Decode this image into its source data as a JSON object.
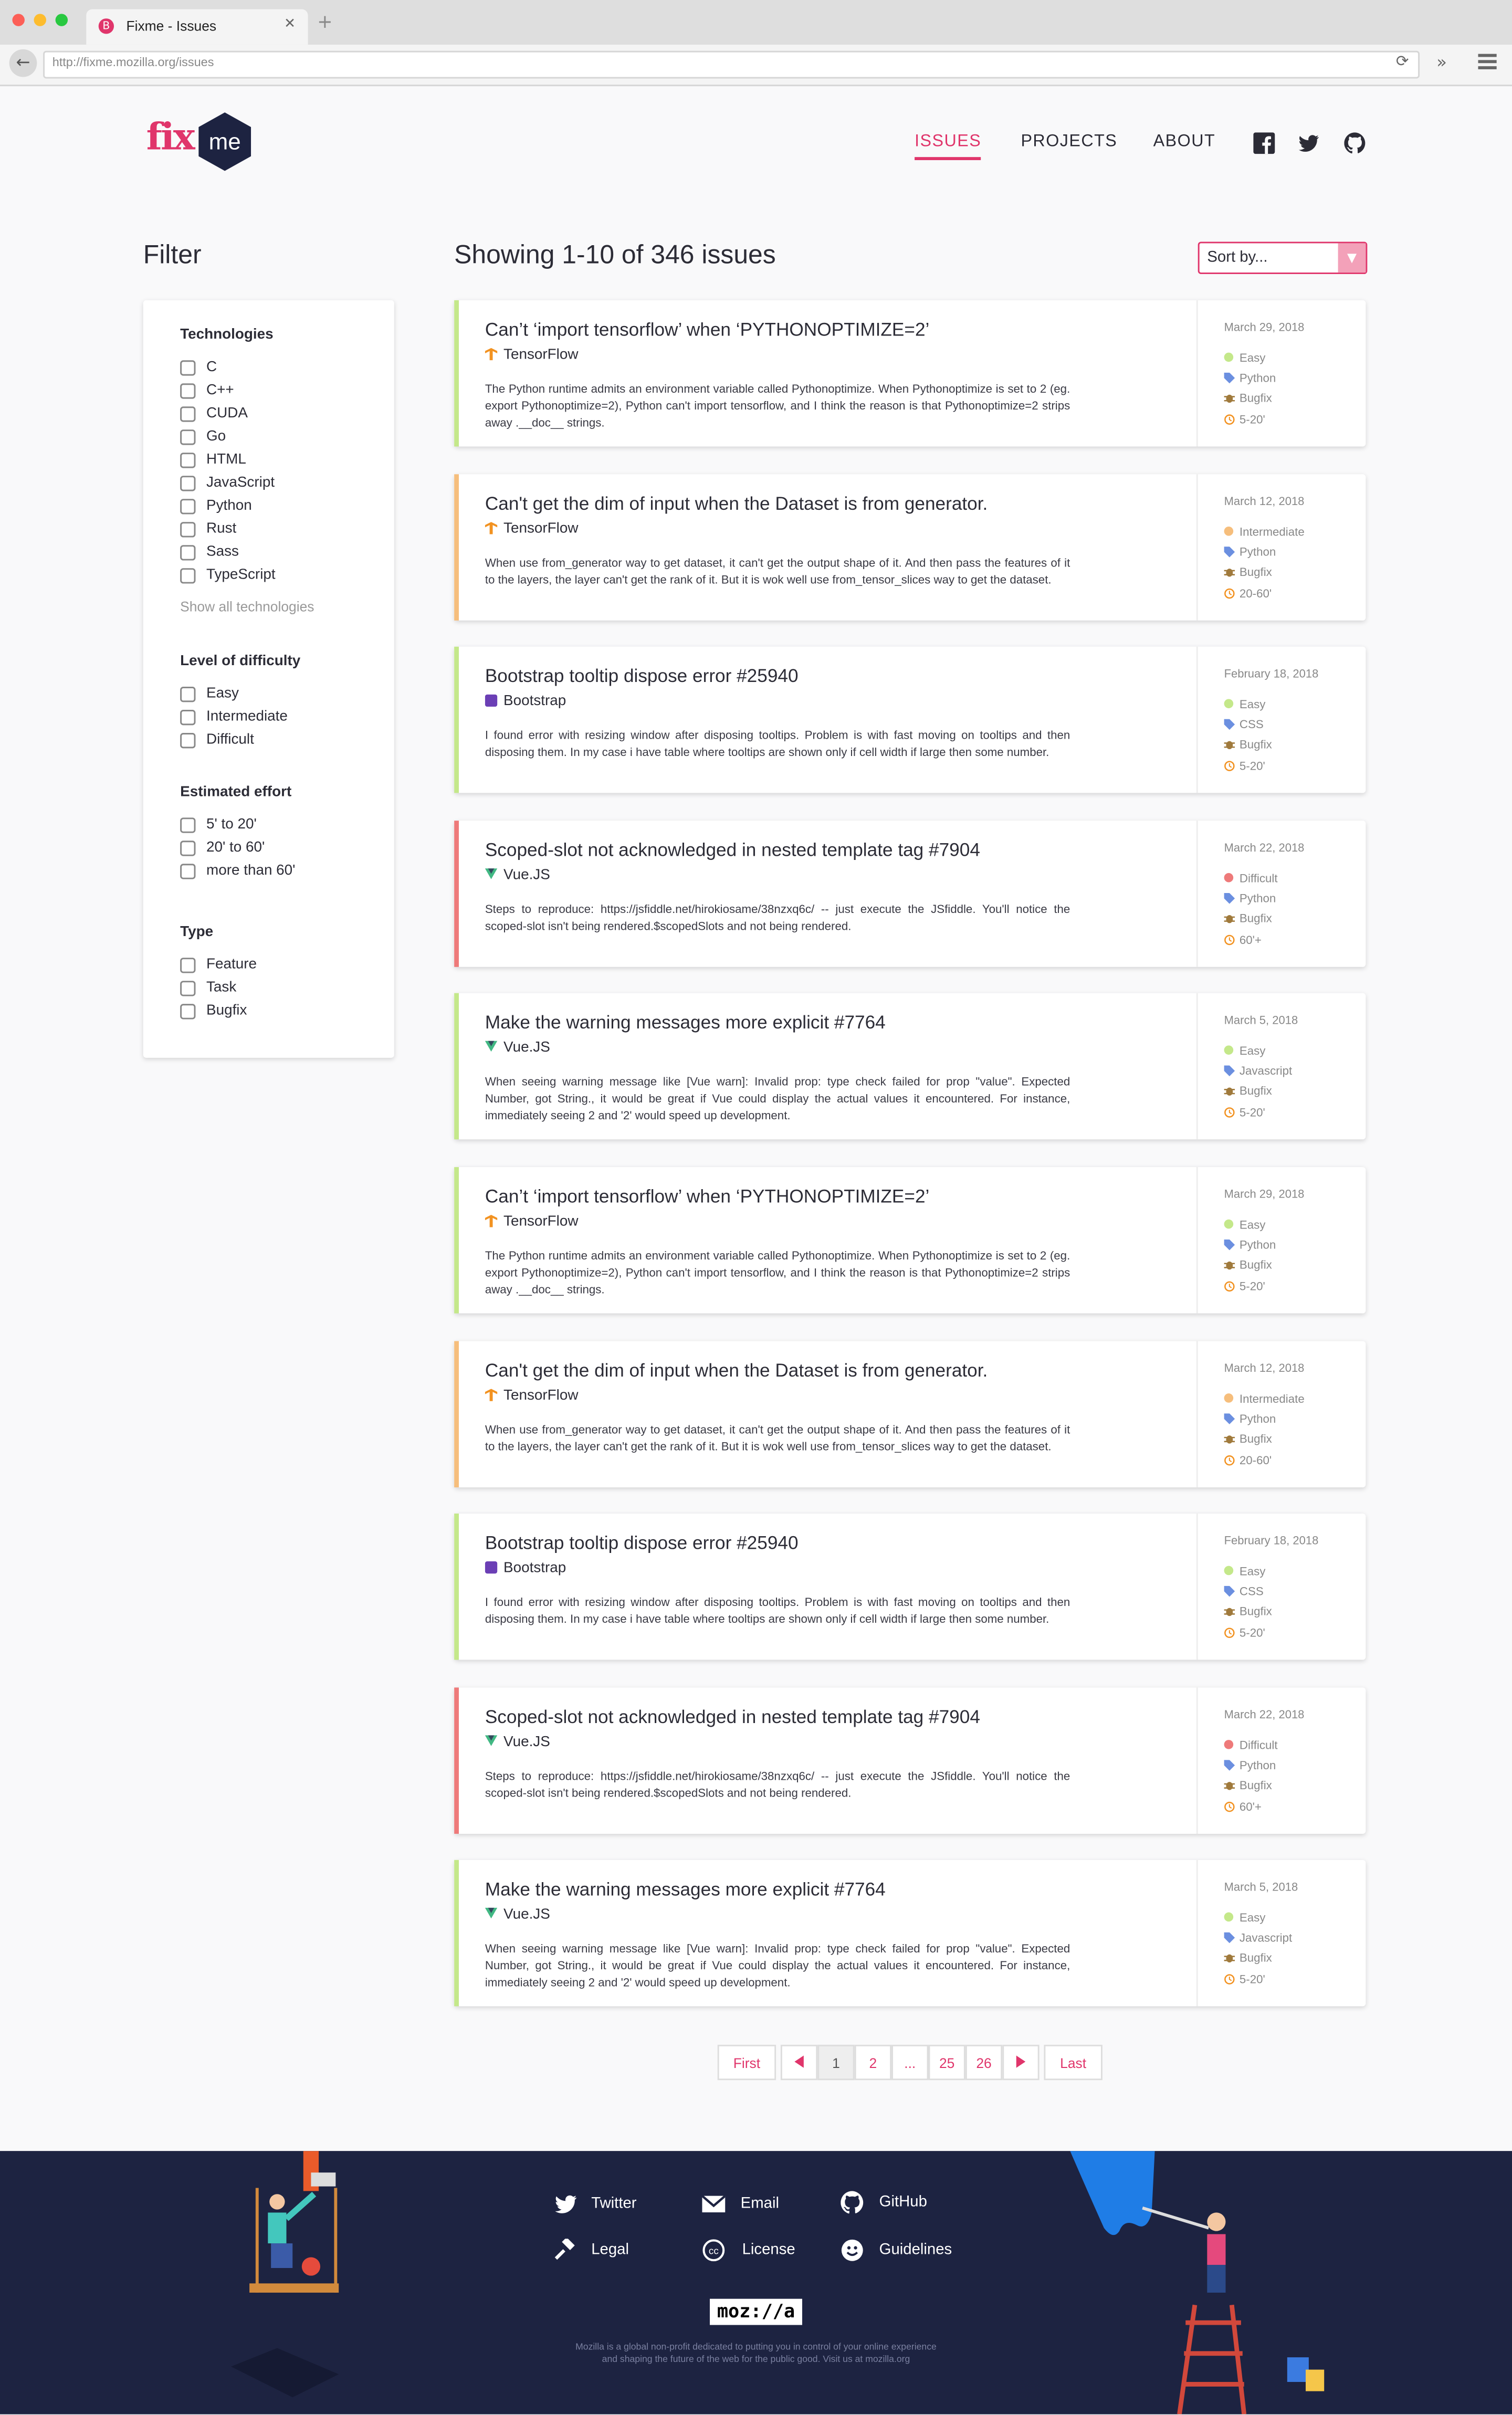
{
  "browser": {
    "tab_title": "Fixme - Issues",
    "url": "http://fixme.mozilla.org/issues"
  },
  "header": {
    "logo_fix": "fix",
    "logo_me": "me",
    "nav": [
      "ISSUES",
      "PROJECTS",
      "ABOUT"
    ]
  },
  "filter": {
    "title": "Filter",
    "groups": [
      {
        "title": "Technologies",
        "options": [
          "C",
          "C++",
          "CUDA",
          "Go",
          "HTML",
          "JavaScript",
          "Python",
          "Rust",
          "Sass",
          "TypeScript"
        ],
        "show_all": "Show all technologies"
      },
      {
        "title": "Level of difficulty",
        "options": [
          "Easy",
          "Intermediate",
          "Difficult"
        ]
      },
      {
        "title": "Estimated effort",
        "options": [
          "5' to 20'",
          "20' to 60'",
          "more than 60'"
        ]
      },
      {
        "title": "Type",
        "options": [
          "Feature",
          "Task",
          "Bugfix"
        ]
      }
    ]
  },
  "results": {
    "showing": "Showing 1-10 of 346 issues",
    "sort_label": "Sort by..."
  },
  "colors": {
    "accent": "#e0356b",
    "easy": "#c4e88a",
    "intermediate": "#f6be7c",
    "difficult": "#ee7a7a",
    "footer_bg": "#1d2341"
  },
  "issues": [
    {
      "title": "Can’t ‘import tensorflow’ when ‘PYTHONOPTIMIZE=2’",
      "tech": "TensorFlow",
      "tech_icon": "tensorflow-icon",
      "desc": "The Python runtime admits an environment variable called Pythonoptimize. When Pythonoptimize is set to 2 (eg. export Pythonoptimize=2), Python can't import tensorflow, and I think the reason is that Pythonoptimize=2 strips away .__doc__ strings.",
      "date": "March 29, 2018",
      "difficulty": "Easy",
      "language": "Python",
      "type": "Bugfix",
      "effort": "5-20'"
    },
    {
      "title": "Can't get the dim of input when the Dataset is from generator.",
      "tech": "TensorFlow",
      "tech_icon": "tensorflow-icon",
      "desc": "When use from_generator way to get dataset, it can't get the output shape of it. And then pass the features of it to the layers, the layer can't get the rank of it. But it is wok well use from_tensor_slices way to get the dataset.",
      "date": "March 12, 2018",
      "difficulty": "Intermediate",
      "language": "Python",
      "type": "Bugfix",
      "effort": "20-60'"
    },
    {
      "title": "Bootstrap tooltip dispose error #25940",
      "tech": "Bootstrap",
      "tech_icon": "bootstrap-icon",
      "desc": "I found error with resizing window after disposing tooltips. Problem is with fast moving on tooltips and then disposing them. In my case i have table where tooltips are shown only if cell width if large then some number.",
      "date": "February 18, 2018",
      "difficulty": "Easy",
      "language": "CSS",
      "type": "Bugfix",
      "effort": "5-20'"
    },
    {
      "title": "Scoped-slot not acknowledged in nested template tag #7904",
      "tech": "Vue.JS",
      "tech_icon": "vue-icon",
      "desc": "Steps to reproduce: https://jsfiddle.net/hirokiosame/38nzxq6c/ -- just execute the JSfiddle. You'll notice the scoped-slot isn't being rendered.$scopedSlots and not being rendered.",
      "date": "March 22, 2018",
      "difficulty": "Difficult",
      "language": "Python",
      "type": "Bugfix",
      "effort": "60'+"
    },
    {
      "title": "Make the warning messages more explicit #7764",
      "tech": "Vue.JS",
      "tech_icon": "vue-icon",
      "desc": "When seeing warning message like [Vue warn]: Invalid prop: type check failed for prop \"value\". Expected Number, got String., it would be great if Vue could display the actual values it encountered. For instance, immediately seeing 2 and '2' would speed up development.",
      "date": "March 5, 2018",
      "difficulty": "Easy",
      "language": "Javascript",
      "type": "Bugfix",
      "effort": "5-20'"
    },
    {
      "title": "Can’t ‘import tensorflow’ when ‘PYTHONOPTIMIZE=2’",
      "tech": "TensorFlow",
      "tech_icon": "tensorflow-icon",
      "desc": "The Python runtime admits an environment variable called Pythonoptimize. When Pythonoptimize is set to 2 (eg. export Pythonoptimize=2), Python can't import tensorflow, and I think the reason is that Pythonoptimize=2 strips away .__doc__ strings.",
      "date": "March 29, 2018",
      "difficulty": "Easy",
      "language": "Python",
      "type": "Bugfix",
      "effort": "5-20'"
    },
    {
      "title": "Can't get the dim of input when the Dataset is from generator.",
      "tech": "TensorFlow",
      "tech_icon": "tensorflow-icon",
      "desc": "When use from_generator way to get dataset, it can't get the output shape of it. And then pass the features of it to the layers, the layer can't get the rank of it. But it is wok well use from_tensor_slices way to get the dataset.",
      "date": "March 12, 2018",
      "difficulty": "Intermediate",
      "language": "Python",
      "type": "Bugfix",
      "effort": "20-60'"
    },
    {
      "title": "Bootstrap tooltip dispose error #25940",
      "tech": "Bootstrap",
      "tech_icon": "bootstrap-icon",
      "desc": "I found error with resizing window after disposing tooltips. Problem is with fast moving on tooltips and then disposing them. In my case i have table where tooltips are shown only if cell width if large then some number.",
      "date": "February 18, 2018",
      "difficulty": "Easy",
      "language": "CSS",
      "type": "Bugfix",
      "effort": "5-20'"
    },
    {
      "title": "Scoped-slot not acknowledged in nested template tag #7904",
      "tech": "Vue.JS",
      "tech_icon": "vue-icon",
      "desc": "Steps to reproduce: https://jsfiddle.net/hirokiosame/38nzxq6c/ -- just execute the JSfiddle. You'll notice the scoped-slot isn't being rendered.$scopedSlots and not being rendered.",
      "date": "March 22, 2018",
      "difficulty": "Difficult",
      "language": "Python",
      "type": "Bugfix",
      "effort": "60'+"
    },
    {
      "title": "Make the warning messages more explicit #7764",
      "tech": "Vue.JS",
      "tech_icon": "vue-icon",
      "desc": "When seeing warning message like [Vue warn]: Invalid prop: type check failed for prop \"value\". Expected Number, got String., it would be great if Vue could display the actual values it encountered. For instance, immediately seeing 2 and '2' would speed up development.",
      "date": "March 5, 2018",
      "difficulty": "Easy",
      "language": "Javascript",
      "type": "Bugfix",
      "effort": "5-20'"
    }
  ],
  "pagination": [
    "First",
    "1",
    "2",
    "...",
    "25",
    "26",
    "Last"
  ],
  "footer": {
    "links": [
      "Twitter",
      "Email",
      "GitHub",
      "Legal",
      "License",
      "Guidelines"
    ],
    "mozilla": "moz://a",
    "mozilla_desc": "Mozilla is a global non-profit dedicated to putting you in control of your online experience and shaping the future of the web for the public good. Visit us at mozilla.org"
  }
}
